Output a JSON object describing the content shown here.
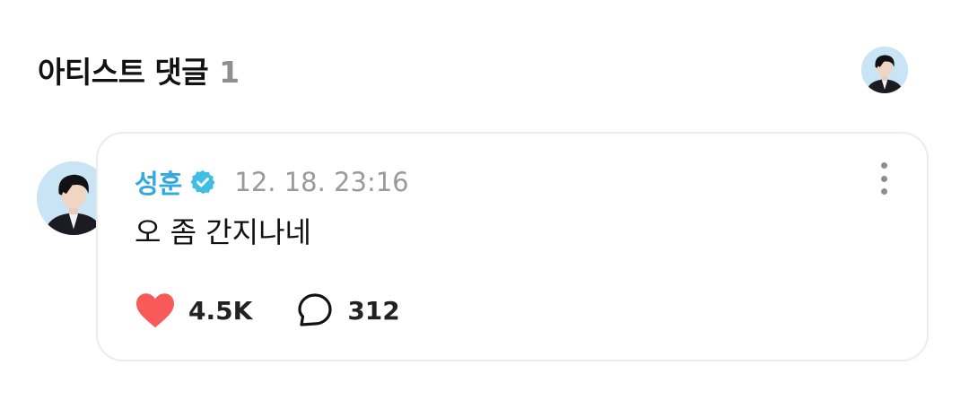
{
  "section": {
    "title": "아티스트 댓글",
    "count": "1"
  },
  "comment": {
    "author": "성훈",
    "timestamp": "12. 18. 23:16",
    "text": "오 좀 간지나네",
    "likes": "4.5K",
    "replies": "312"
  },
  "colors": {
    "author": "#34a9e0",
    "verified_badge": "#3fbde4",
    "heart": "#f85a5a",
    "muted": "#9a9a9a",
    "card_border": "#ececec"
  },
  "icons": {
    "verified": "verified-badge-icon",
    "like": "heart-icon",
    "reply": "speech-bubble-icon",
    "more": "more-vertical-icon"
  }
}
